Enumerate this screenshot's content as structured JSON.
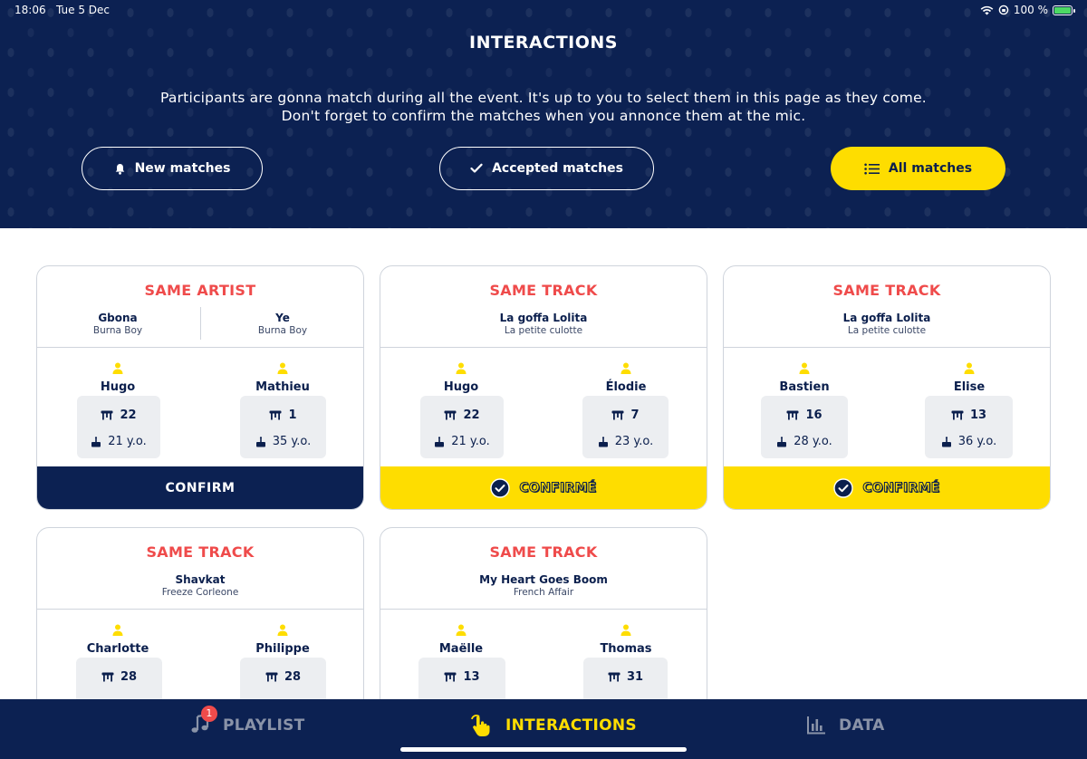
{
  "status_bar": {
    "time": "18:06",
    "date": "Tue 5 Dec",
    "battery": "100 %"
  },
  "header": {
    "title": "INTERACTIONS",
    "intro_line1": "Participants are gonna match during all the event. It's up to you to select them in this page as they come.",
    "intro_line2": "Don't forget to confirm the matches when you annonce them at the mic."
  },
  "filters": {
    "new_matches": "New matches",
    "accepted_matches": "Accepted matches",
    "all_matches": "All matches",
    "active": "all_matches"
  },
  "cards": [
    {
      "type": "SAME ARTIST",
      "tracks": [
        {
          "title": "Gbona",
          "artist": "Burna Boy"
        },
        {
          "title": "Ye",
          "artist": "Burna Boy"
        }
      ],
      "people": [
        {
          "name": "Hugo",
          "table": "22",
          "age": "21 y.o."
        },
        {
          "name": "Mathieu",
          "table": "1",
          "age": "35 y.o."
        }
      ],
      "action": "CONFIRM"
    },
    {
      "type": "SAME TRACK",
      "track": {
        "title": "La goffa Lolita",
        "artist": "La petite culotte"
      },
      "people": [
        {
          "name": "Hugo",
          "table": "22",
          "age": "21 y.o."
        },
        {
          "name": "Élodie",
          "table": "7",
          "age": "23 y.o."
        }
      ],
      "action": "CONFIRMÉ"
    },
    {
      "type": "SAME TRACK",
      "track": {
        "title": "La goffa Lolita",
        "artist": "La petite culotte"
      },
      "people": [
        {
          "name": "Bastien",
          "table": "16",
          "age": "28 y.o."
        },
        {
          "name": "Elise",
          "table": "13",
          "age": "36 y.o."
        }
      ],
      "action": "CONFIRMÉ"
    },
    {
      "type": "SAME TRACK",
      "track": {
        "title": "Shavkat",
        "artist": "Freeze Corleone"
      },
      "people": [
        {
          "name": "Charlotte",
          "table": "28"
        },
        {
          "name": "Philippe",
          "table": "28"
        }
      ]
    },
    {
      "type": "SAME TRACK",
      "track": {
        "title": "My Heart Goes Boom",
        "artist": "French Affair"
      },
      "people": [
        {
          "name": "Maëlle",
          "table": "13"
        },
        {
          "name": "Thomas",
          "table": "31"
        }
      ]
    }
  ],
  "tab_bar": {
    "playlist": "PLAYLIST",
    "playlist_badge": "1",
    "interactions": "INTERACTIONS",
    "data": "DATA",
    "active": "interactions"
  },
  "colors": {
    "navy": "#0c2152",
    "yellow": "#fedd00",
    "coral": "#ef4b4b",
    "stat_bg": "#eceef1"
  },
  "icons": {
    "new_matches": "bell-icon",
    "accepted_matches": "check-icon",
    "all_matches": "list-icon",
    "person": "person-icon",
    "table": "table-icon",
    "age": "cake-icon",
    "confirmed": "check-circle-icon",
    "playlist": "music-note-icon",
    "interactions": "tap-hand-icon",
    "data": "bar-chart-icon"
  }
}
